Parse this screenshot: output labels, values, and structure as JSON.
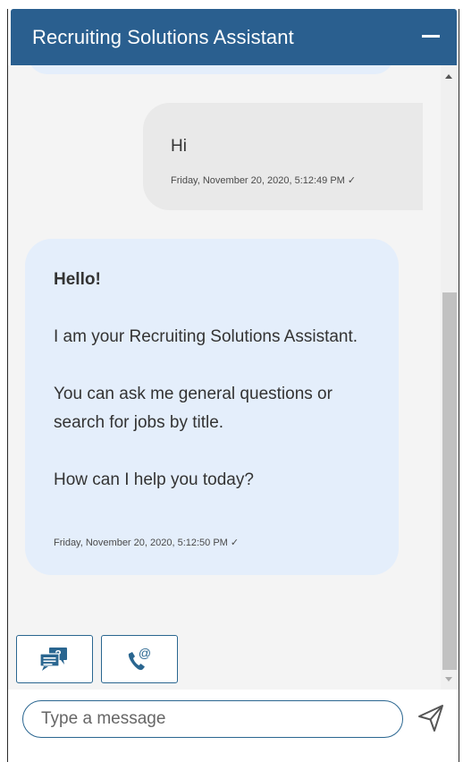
{
  "header": {
    "title": "Recruiting Solutions Assistant"
  },
  "user_message": {
    "text": "Hi",
    "timestamp": "Friday, November 20, 2020, 5:12:49 PM ✓"
  },
  "bot_message": {
    "greeting": "Hello!",
    "paragraphs": [
      "I am your Recruiting Solutions Assistant.",
      "You can ask me general questions or search for jobs by title."
    ],
    "question": "How can I help you today?",
    "timestamp": "Friday, November 20, 2020, 5:12:50 PM ✓"
  },
  "quick_actions": [
    {
      "icon": "faq-chat-icon"
    },
    {
      "icon": "phone-email-icon"
    }
  ],
  "composer": {
    "placeholder": "Type a message",
    "value": ""
  },
  "colors": {
    "header": "#2a5f8f",
    "bot_bubble": "#e4eefb",
    "user_bubble": "#e9e9e9",
    "accent": "#2a6690"
  }
}
